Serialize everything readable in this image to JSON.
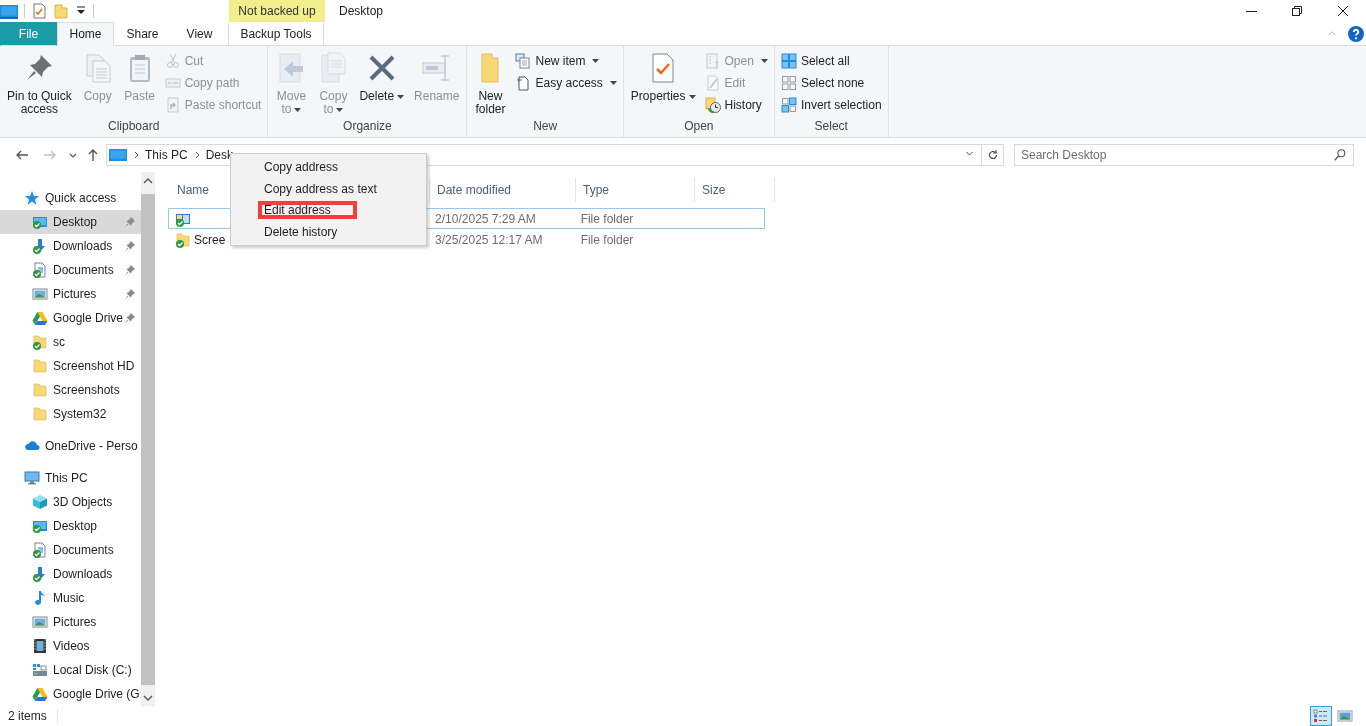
{
  "title_bar": {
    "context_label": "Not backed up",
    "title": "Desktop"
  },
  "tabs": [
    {
      "label": "File",
      "kind": "file",
      "selected": false
    },
    {
      "label": "Home",
      "kind": "main",
      "selected": true
    },
    {
      "label": "Share",
      "kind": "main",
      "selected": false
    },
    {
      "label": "View",
      "kind": "main",
      "selected": false
    },
    {
      "label": "Backup Tools",
      "kind": "context",
      "selected": false
    }
  ],
  "ribbon": [
    {
      "label": "Clipboard",
      "buttons": [
        {
          "label": "Pin to Quick\naccess",
          "kind": "large",
          "disabled": false,
          "dropdown": false
        },
        {
          "label": "Copy",
          "kind": "large",
          "disabled": true,
          "dropdown": false
        },
        {
          "label": "Paste",
          "kind": "large",
          "disabled": true,
          "dropdown": false
        },
        {
          "label": "Cut",
          "kind": "small",
          "disabled": true,
          "dropdown": false
        },
        {
          "label": "Copy path",
          "kind": "small",
          "disabled": true,
          "dropdown": false
        },
        {
          "label": "Paste shortcut",
          "kind": "small",
          "disabled": true,
          "dropdown": false
        }
      ]
    },
    {
      "label": "Organize",
      "buttons": [
        {
          "label": "Move\nto",
          "kind": "large",
          "disabled": true,
          "dropdown": true
        },
        {
          "label": "Copy\nto",
          "kind": "large",
          "disabled": true,
          "dropdown": true
        },
        {
          "label": "Delete",
          "kind": "large",
          "disabled": false,
          "dropdown": true
        },
        {
          "label": "Rename",
          "kind": "large",
          "disabled": true,
          "dropdown": false
        }
      ]
    },
    {
      "label": "New",
      "buttons": [
        {
          "label": "New\nfolder",
          "kind": "large",
          "disabled": false,
          "dropdown": false
        },
        {
          "label": "New item",
          "kind": "small",
          "disabled": false,
          "dropdown": true
        },
        {
          "label": "Easy access",
          "kind": "small",
          "disabled": false,
          "dropdown": true
        }
      ]
    },
    {
      "label": "Open",
      "buttons": [
        {
          "label": "Properties",
          "kind": "large",
          "disabled": false,
          "dropdown": true
        },
        {
          "label": "Open",
          "kind": "small",
          "disabled": true,
          "dropdown": true
        },
        {
          "label": "Edit",
          "kind": "small",
          "disabled": true,
          "dropdown": false
        },
        {
          "label": "History",
          "kind": "small",
          "disabled": false,
          "dropdown": false
        }
      ]
    },
    {
      "label": "Select",
      "buttons": [
        {
          "label": "Select all",
          "kind": "small",
          "disabled": false,
          "dropdown": false
        },
        {
          "label": "Select none",
          "kind": "small",
          "disabled": false,
          "dropdown": false
        },
        {
          "label": "Invert selection",
          "kind": "small",
          "disabled": false,
          "dropdown": false
        }
      ]
    }
  ],
  "nav_buttons": [
    {
      "kind": "back",
      "disabled": false
    },
    {
      "kind": "forward",
      "disabled": true
    },
    {
      "kind": "recent",
      "disabled": false
    },
    {
      "kind": "up",
      "disabled": false
    }
  ],
  "address": {
    "crumbs": [
      "This PC",
      "Desk"
    ]
  },
  "search": {
    "placeholder": "Search Desktop"
  },
  "navigation": [
    {
      "label": "Quick access",
      "kind": "star",
      "children": [
        {
          "label": "Desktop",
          "kind": "desktop",
          "pinned": true,
          "selected": true
        },
        {
          "label": "Downloads",
          "kind": "downloads",
          "pinned": true,
          "selected": false
        },
        {
          "label": "Documents",
          "kind": "documents",
          "pinned": true,
          "selected": false
        },
        {
          "label": "Pictures",
          "kind": "pictures",
          "pinned": true,
          "selected": false
        },
        {
          "label": "Google Drive",
          "kind": "drive",
          "pinned": true,
          "selected": false
        },
        {
          "label": "sc",
          "kind": "synced-folder",
          "pinned": false,
          "selected": false
        },
        {
          "label": "Screenshot HD",
          "kind": "folder",
          "pinned": false,
          "selected": false
        },
        {
          "label": "Screenshots",
          "kind": "folder",
          "pinned": false,
          "selected": false
        },
        {
          "label": "System32",
          "kind": "folder",
          "pinned": false,
          "selected": false
        }
      ]
    },
    {
      "label": "OneDrive - Perso",
      "kind": "cloud"
    },
    {
      "label": "This PC",
      "kind": "pc",
      "children": [
        {
          "label": "3D Objects",
          "kind": "cube",
          "pinned": false,
          "selected": false
        },
        {
          "label": "Desktop",
          "kind": "desktop",
          "pinned": false,
          "selected": false
        },
        {
          "label": "Documents",
          "kind": "documents",
          "pinned": false,
          "selected": false
        },
        {
          "label": "Downloads",
          "kind": "downloads",
          "pinned": false,
          "selected": false
        },
        {
          "label": "Music",
          "kind": "music",
          "pinned": false,
          "selected": false
        },
        {
          "label": "Pictures",
          "kind": "pictures",
          "pinned": false,
          "selected": false
        },
        {
          "label": "Videos",
          "kind": "videos",
          "pinned": false,
          "selected": false
        },
        {
          "label": "Local Disk (C:)",
          "kind": "disk",
          "pinned": false,
          "selected": false
        },
        {
          "label": "Google Drive (G:",
          "kind": "drive",
          "pinned": false,
          "selected": false
        }
      ]
    }
  ],
  "table": {
    "columns": [
      "Name",
      "Date modified",
      "Type",
      "Size"
    ],
    "rows": [
      {
        "kind": "desktop",
        "date_modified": "2/10/2025 7:29 AM",
        "type": "File folder",
        "focused": true
      },
      {
        "kind": "folder",
        "name": "Scree",
        "date_modified": "3/25/2025 12:17 AM",
        "type": "File folder",
        "focused": false
      }
    ]
  },
  "context_menu": [
    {
      "label": "Copy address",
      "highlighted": false
    },
    {
      "label": "Copy address as text",
      "highlighted": false
    },
    {
      "label": "Edit address",
      "highlighted": true
    },
    {
      "label": "Delete history",
      "highlighted": false
    }
  ],
  "status_bar": {
    "item_count": "2 items",
    "views": [
      {
        "kind": "details",
        "selected": true
      },
      {
        "kind": "large_icons",
        "selected": false
      }
    ]
  }
}
